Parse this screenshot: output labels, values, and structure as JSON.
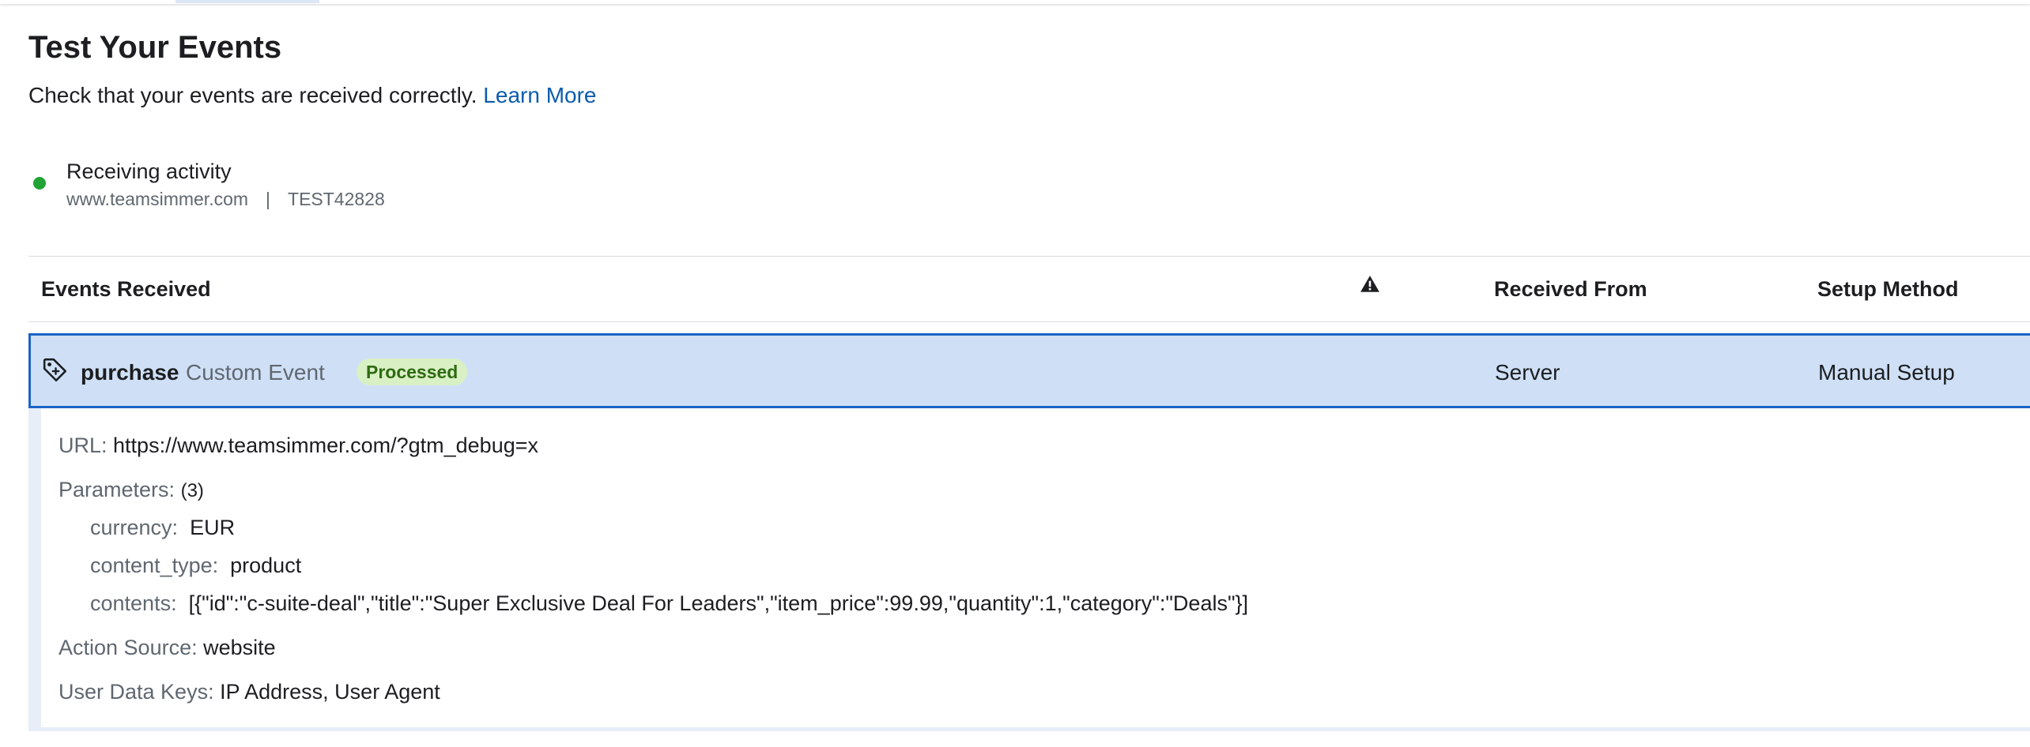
{
  "page": {
    "title": "Test Your Events",
    "subtitle": "Check that your events are received correctly.",
    "learn_more": "Learn More"
  },
  "status": {
    "label": "Receiving activity",
    "domain": "www.teamsimmer.com",
    "separator": "|",
    "test_code": "TEST42828",
    "color": "#21a336"
  },
  "table": {
    "headers": {
      "events_received": "Events Received",
      "warning_icon": "warning-icon",
      "received_from": "Received From",
      "setup_method": "Setup Method"
    }
  },
  "event": {
    "icon": "tag-icon",
    "name": "purchase",
    "type": "Custom Event",
    "badge": "Processed",
    "received_from": "Server",
    "setup_method": "Manual Setup",
    "details": {
      "url_label": "URL:",
      "url": "https://www.teamsimmer.com/?gtm_debug=x",
      "params_label": "Parameters:",
      "params_count": "(3)",
      "params": [
        {
          "key": "currency:",
          "value": "EUR"
        },
        {
          "key": "content_type:",
          "value": "product"
        },
        {
          "key": "contents:",
          "value": "[{\"id\":\"c-suite-deal\",\"title\":\"Super Exclusive Deal For Leaders\",\"item_price\":99.99,\"quantity\":1,\"category\":\"Deals\"}]"
        }
      ],
      "action_source_label": "Action Source:",
      "action_source": "website",
      "user_data_label": "User Data Keys:",
      "user_data": "IP Address, User Agent"
    }
  },
  "colors": {
    "accent": "#1a64c6",
    "row_selected": "#cfe0f6",
    "link": "#0b5cad",
    "badge_bg": "#d9f0c4",
    "badge_text": "#2f6a13"
  }
}
